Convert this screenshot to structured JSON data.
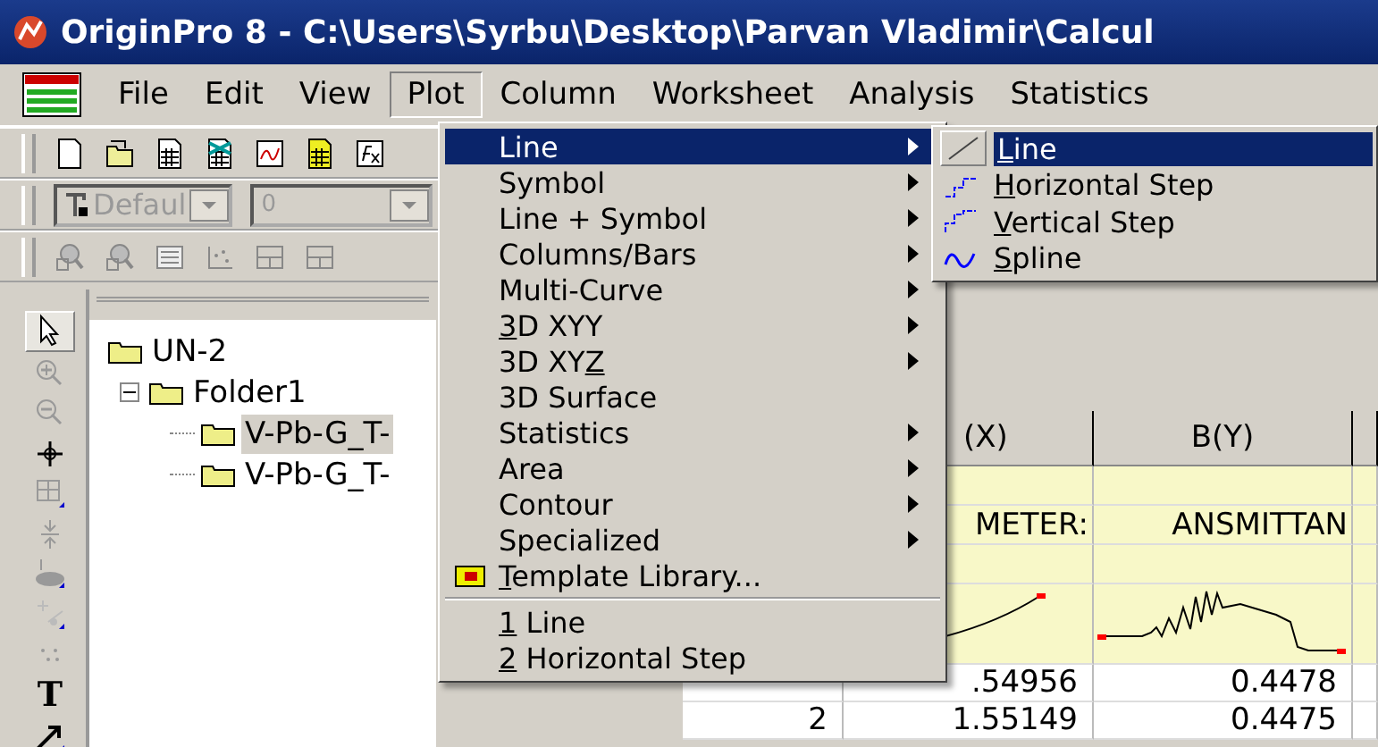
{
  "window": {
    "title": "OriginPro 8 - C:\\Users\\Syrbu\\Desktop\\Parvan Vladimir\\Calcul"
  },
  "menu_bar": [
    {
      "label": "File",
      "selected": false
    },
    {
      "label": "Edit",
      "selected": false
    },
    {
      "label": "View",
      "selected": false
    },
    {
      "label": "Plot",
      "selected": true
    },
    {
      "label": "Column",
      "selected": false
    },
    {
      "label": "Worksheet",
      "selected": false
    },
    {
      "label": "Analysis",
      "selected": false
    },
    {
      "label": "Statistics",
      "selected": false
    }
  ],
  "format_toolbar": {
    "font": "Defaul",
    "size": "0"
  },
  "tools": [
    {
      "kind": "pointer",
      "selected": true
    },
    {
      "kind": "zoom-in",
      "selected": false
    },
    {
      "kind": "zoom-out",
      "selected": false
    },
    {
      "kind": "crosshair",
      "selected": false
    },
    {
      "kind": "grid",
      "selected": false
    },
    {
      "kind": "arrows",
      "selected": false
    },
    {
      "kind": "mask",
      "selected": false
    },
    {
      "kind": "scatter",
      "selected": false
    },
    {
      "kind": "dots",
      "selected": false
    },
    {
      "kind": "text",
      "glyph": "T",
      "selected": false
    },
    {
      "kind": "arrow",
      "selected": false
    }
  ],
  "project_explorer": {
    "root": "UN-2",
    "children": [
      {
        "label": "Folder1",
        "expanded": true,
        "children": [
          {
            "label": "V-Pb-G_T-",
            "selected": true
          },
          {
            "label": "V-Pb-G_T-",
            "selected": false
          }
        ]
      }
    ]
  },
  "worksheet": {
    "columns": [
      "(X)",
      "B(Y)"
    ],
    "label_row": [
      "METER:",
      "ANSMITTAN"
    ],
    "rows": [
      {
        "a": ".54956",
        "b": "0.4478"
      },
      {
        "number": "2",
        "a": "1.55149",
        "b": "0.4475"
      }
    ]
  },
  "plot_menu": [
    {
      "before": "Line",
      "submenu": true,
      "selected": true
    },
    {
      "before": "Symbol",
      "submenu": true,
      "selected": false
    },
    {
      "before": "Line + Symbol",
      "submenu": true,
      "selected": false
    },
    {
      "before": "Columns/Bars",
      "submenu": true,
      "selected": false
    },
    {
      "before": "Multi-Curve",
      "submenu": true,
      "selected": false
    },
    {
      "key": "3",
      "after": "D XYY",
      "submenu": true,
      "selected": false
    },
    {
      "before": "3D XY",
      "key": "Z",
      "submenu": true,
      "selected": false
    },
    {
      "before": "3D Surface",
      "submenu": false,
      "selected": false
    },
    {
      "before": "Statistics",
      "submenu": true,
      "selected": false
    },
    {
      "before": "Area",
      "submenu": true,
      "selected": false
    },
    {
      "before": "Contour",
      "submenu": true,
      "selected": false
    },
    {
      "before": "Specialized",
      "submenu": true,
      "selected": false
    },
    {
      "key": "T",
      "after": "emplate Library...",
      "submenu": false,
      "selected": false,
      "kind": "template"
    },
    {
      "kind": "separator"
    },
    {
      "key": "1",
      "after": " Line",
      "submenu": false,
      "selected": false
    },
    {
      "key": "2",
      "after": " Horizontal Step",
      "submenu": false,
      "selected": false
    }
  ],
  "line_submenu": [
    {
      "kind": "line",
      "key": "L",
      "after": "ine",
      "selected": true
    },
    {
      "kind": "hstep",
      "key": "H",
      "after": "orizontal Step",
      "selected": false
    },
    {
      "kind": "vstep",
      "key": "V",
      "after": "ertical Step",
      "selected": false
    },
    {
      "kind": "spline",
      "key": "S",
      "after": "pline",
      "selected": false
    }
  ]
}
